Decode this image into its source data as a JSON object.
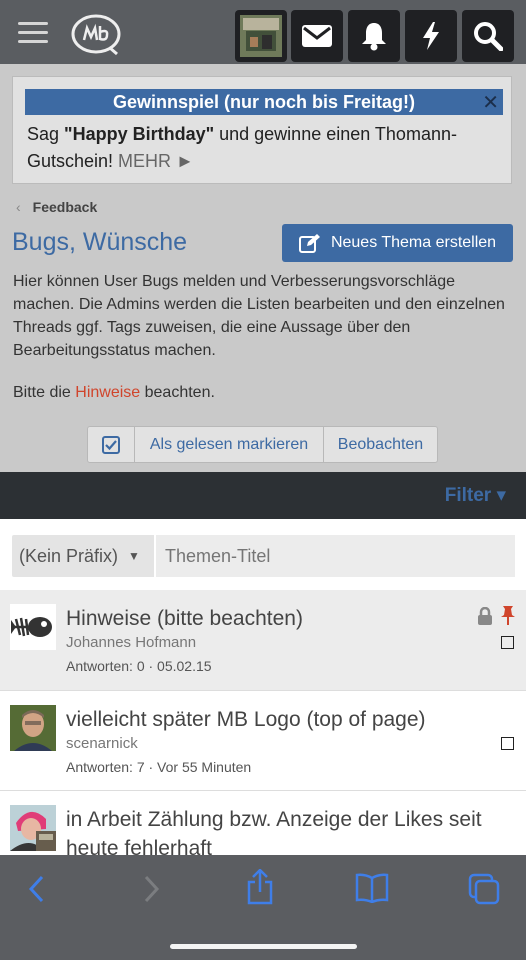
{
  "header": {
    "menu_icon": "hamburger-icon",
    "logo_icon": "mb-logo",
    "buttons": [
      "avatar",
      "mail-icon",
      "bell-icon",
      "flash-icon",
      "search-icon"
    ]
  },
  "notice": {
    "title": "Gewinnspiel (nur noch bis Freitag!)",
    "close": "✕",
    "text_prefix": "Sag ",
    "text_bold": "\"Happy Birthday\"",
    "text_suffix": " und gewinne einen Thomann-Gutschein! ",
    "more": "MEHR ►"
  },
  "breadcrumb": {
    "label": "Feedback"
  },
  "page": {
    "title": "Bugs, Wünsche",
    "new_thread": "Neues Thema erstellen",
    "description": "Hier können User Bugs melden und Verbesserungsvorschläge machen. Die Admins werden die Listen bearbeiten und den einzelnen Threads ggf. Tags zuweisen, die eine Aussage über den Bearbeitungsstatus machen.",
    "hint_prefix": "Bitte die ",
    "hint_link": "Hinweise",
    "hint_suffix": " beachten."
  },
  "actions": {
    "mark_read": "Als gelesen markieren",
    "watch": "Beobachten"
  },
  "filter": {
    "label": "Filter ▾"
  },
  "search": {
    "prefix": "(Kein Präfix)",
    "placeholder": "Themen-Titel"
  },
  "threads": [
    {
      "title": "Hinweise (bitte beachten)",
      "author": "Johannes Hofmann",
      "meta": "Antworten: 0 · 05.02.15",
      "locked": true,
      "pinned": true
    },
    {
      "title": "vielleicht später MB Logo (top of page)",
      "author": "scenarnick",
      "meta": "Antworten: 7 · Vor 55 Minuten"
    },
    {
      "title": "in Arbeit Zählung bzw. Anzeige der Likes seit heute fehlerhaft",
      "author": "",
      "meta": ""
    }
  ],
  "colors": {
    "accent": "#3d6aa3",
    "link_red": "#d0452c",
    "topbar": "#5a5d61",
    "filterbar": "#2c3034"
  }
}
